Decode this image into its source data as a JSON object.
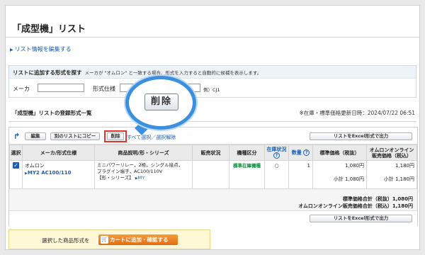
{
  "page": {
    "title": "「成型機」リスト",
    "edit_link": "リスト情報を編集する"
  },
  "search": {
    "heading": "リストに追加する形式を探す",
    "hint": "メーカが \"オムロン\" と一致する場合、形式を入力すると自動的に候補を表示します。",
    "maker_label": "メーカ",
    "spec_label": "形式仕様",
    "example": "例）CJ1"
  },
  "list": {
    "heading": "「成型機」リストの登録形式一覧",
    "updated": "※在庫・標準価格更新日時：2024/07/22 06:51"
  },
  "toolbar": {
    "edit": "編集",
    "copy": "別のリストにコピー",
    "delete": "削除",
    "select_all": "すべて選択／選択解除",
    "excel": "リストをExcel形式で出力"
  },
  "table": {
    "headers": {
      "select": "選択",
      "maker": "メーカ/形式仕様",
      "desc": "商品説明/形・シリーズ",
      "sales": "販売状況",
      "category": "機種区分",
      "stock": "在庫状況",
      "qty": "数量",
      "std_price": "標準価格（税抜）",
      "online_price": "オムロンオンライン販売価格（税込）"
    },
    "row": {
      "maker": "オムロン",
      "model": "MY2 AC100/110",
      "desc_lines": [
        "ミニパワーリレー，2極，シングル接点，",
        "プラグイン端子，AC100/110V",
        "【形・シリーズ】"
      ],
      "series_link": "MY",
      "category": "標準在庫機種",
      "stock": "○",
      "qty": "1",
      "std_price": "1,080円",
      "std_subtotal": "小計 1,080円",
      "online_price": "1,180円",
      "online_subtotal": "小計 1,180円"
    },
    "totals": {
      "std": "標準価格合計（税抜）1,080円",
      "online": "オムロンオンライン販売価格合計（税込）1,180円"
    }
  },
  "cart": {
    "text": "選択した商品形式を",
    "button": "カートに追加・確認する"
  },
  "magnifier": {
    "label": "削除"
  },
  "colors": {
    "link": "#1a5fb4",
    "highlight": "#e53030",
    "magnifier_ring": "#3a8fe0",
    "cart_button": "#e26d10"
  }
}
